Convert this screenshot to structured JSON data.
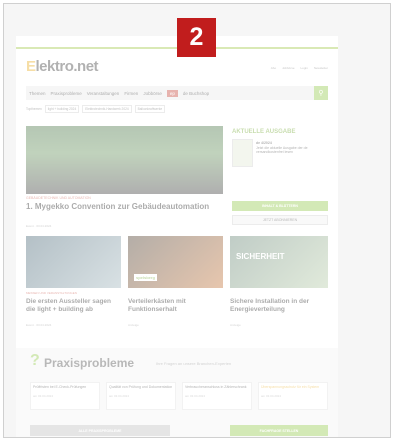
{
  "badge": "2",
  "logo": {
    "prefix": "E",
    "rest": "lektro.net"
  },
  "top_links": [
    "Abo",
    "Jobbörse",
    "Login",
    "Newsletter"
  ],
  "nav": {
    "items": [
      "Themen",
      "Praxisprobleme",
      "Veranstaltungen",
      "Firmen",
      "Jobbörse",
      "de Buchshop"
    ],
    "highlight": "ep"
  },
  "tags": {
    "label": "Topthemen",
    "items": [
      "light + building 2024",
      "Elektrotechnik-Handwerk 2024",
      "Balkonkraftwerke"
    ]
  },
  "hero": {
    "category": "GEBÄUDETECHNIK UND AUTOMATION",
    "title": "1. Mygekko Convention zur Gebäudeautomation",
    "date": "Event · 03.04.2024"
  },
  "sidebar": {
    "title": "AKTUELLE AUSGABE",
    "issue": "de 4/2024",
    "text": "Jetzt die aktuelle Ausgabe der de versandkostenfrei lesen",
    "btn_primary": "INHALT & BLÄTTERN",
    "btn_secondary": "JETZT ABONNIEREN"
  },
  "cards": [
    {
      "category": "MESSEN UND VERANSTALTUNGEN",
      "title": "Die ersten Aussteller sagen die light + building ab",
      "date": "Event · 03.04.2024"
    },
    {
      "category": "",
      "title": "Verteilerkästen mit Funktionserhalt",
      "date": "Anzeige",
      "logo": "spelsberg"
    },
    {
      "category": "",
      "title": "Sichere Installation in der Energieverteilung",
      "date": "Anzeige",
      "img_text": "SICHERHEIT"
    }
  ],
  "praxis": {
    "title": "Praxisprobleme",
    "subtitle": "Ihre Fragen an unsere Branchen-Experten",
    "boxes": [
      {
        "text": "Prüffristen bei E-Check-Prüfungen",
        "date": "am 03.04.2024"
      },
      {
        "text": "Qualität von Prüfung und Dokumentation",
        "date": "am 03.04.2024"
      },
      {
        "text": "Verbraucheranschluss in Zählerschrank",
        "date": "am 03.04.2024"
      },
      {
        "text": "Überspannungsschutz für ein System",
        "date": "am 03.04.2024"
      }
    ],
    "btn_all": "ALLE PRAXISPROBLEME",
    "btn_ask": "FACHFRAGE STELLEN"
  }
}
